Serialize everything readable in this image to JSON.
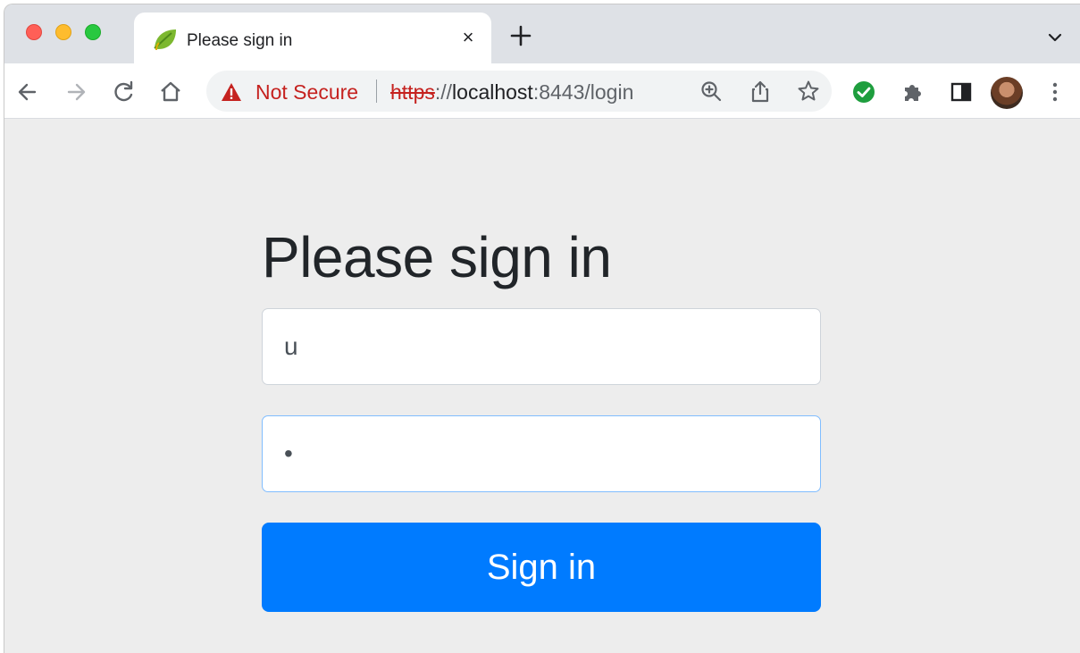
{
  "tab": {
    "title": "Please sign in",
    "close_glyph": "×"
  },
  "omnibox": {
    "security_label": "Not Secure",
    "url_scheme": "https",
    "url_rest_a": "://",
    "url_host": "localhost",
    "url_rest_b": ":8443/login"
  },
  "toolbar_icons": [
    "back-arrow-icon",
    "forward-arrow-icon",
    "reload-icon",
    "home-icon",
    "zoom-icon",
    "share-icon",
    "bookmark-star-icon",
    "extension-check-icon",
    "puzzle-icon",
    "side-panel-icon",
    "avatar",
    "kebab-menu-icon"
  ],
  "page": {
    "heading": "Please sign in",
    "username_value": "u",
    "password_value": "•",
    "button_label": "Sign in"
  },
  "colors": {
    "accent": "#007bff",
    "not_secure": "#c5221f",
    "focus_border": "#80bdff"
  }
}
